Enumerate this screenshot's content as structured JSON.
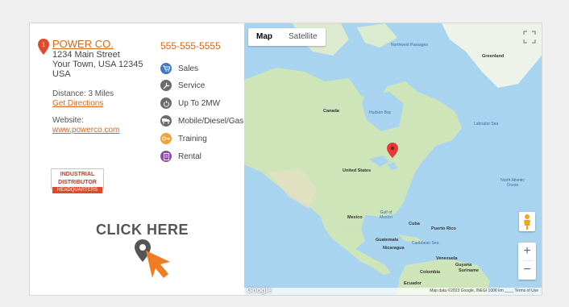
{
  "dealer": {
    "pin_number": "1",
    "name": "POWER CO.",
    "address_lines": [
      "1234 Main Street",
      "Your Town, USA 12345",
      "USA"
    ],
    "phone": "555-555-5555",
    "distance": "Distance: 3 Miles",
    "directions_link": "Get Directions",
    "website_label": "Website:",
    "website": "www.powerco.com"
  },
  "services": [
    {
      "label": "Sales",
      "icon": "cart-icon",
      "color": "#3d78c8"
    },
    {
      "label": "Service",
      "icon": "wrench-icon",
      "color": "#6b6b6b"
    },
    {
      "label": "Up To 2MW",
      "icon": "power-icon",
      "color": "#6b6b6b"
    },
    {
      "label": "Mobile/Diesel/Gas",
      "icon": "truck-icon",
      "color": "#6b6b6b"
    },
    {
      "label": "Training",
      "icon": "key-icon",
      "color": "#f2a23a"
    },
    {
      "label": "Rental",
      "icon": "document-icon",
      "color": "#8a4ba5"
    }
  ],
  "badge": {
    "line1": "INDUSTRIAL",
    "line2": "DISTRIBUTOR",
    "line3": "HEADQUARTERS"
  },
  "cta": {
    "label": "CLICK HERE"
  },
  "map": {
    "tab_map": "Map",
    "tab_satellite": "Satellite",
    "zoom_in": "+",
    "zoom_out": "−",
    "google": "Google",
    "attribution": "Map data ©2023 Google, INEGI   1000 km ____   Terms of Use",
    "labels": {
      "greenland": "Greenland",
      "canada": "Canada",
      "hudson_bay": "Hudson Bay",
      "labrador_sea": "Labrador Sea",
      "united_states": "United States",
      "north_atlantic": "North Atlantic Ocean",
      "gulf_mexico": "Gulf of Mexico",
      "mexico": "Mexico",
      "cuba": "Cuba",
      "puerto_rico": "Puerto Rico",
      "guatemala": "Guatemala",
      "nicaragua": "Nicaragua",
      "caribbean_sea": "Caribbean Sea",
      "venezuela": "Venezuela",
      "guyana": "Guyana",
      "suriname": "Suriname",
      "colombia": "Colombia",
      "ecuador": "Ecuador",
      "northwest_passages": "Northwest Passages"
    }
  },
  "colors": {
    "accent": "#d2691e",
    "map_water": "#a9d4f0",
    "map_land": "#cde5b8",
    "pin": "#e53935"
  }
}
